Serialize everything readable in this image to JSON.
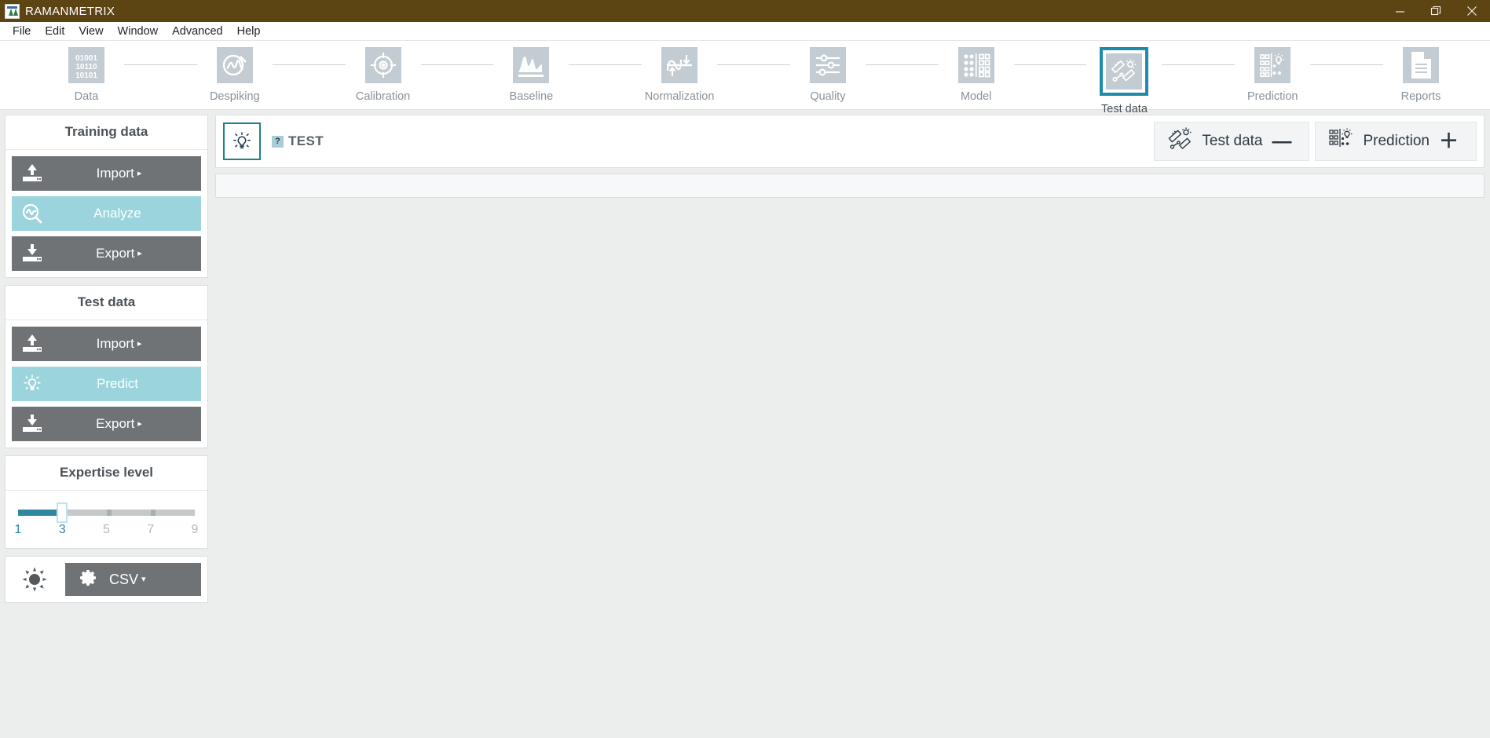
{
  "window": {
    "title": "RAMANMETRIX",
    "logo_icon": "app-logo-icon",
    "minimize_icon": "minimize-icon",
    "maximize_icon": "restore-icon",
    "close_icon": "close-icon",
    "titlebar_color": "#5c4413"
  },
  "menubar": {
    "items": [
      {
        "label": "File"
      },
      {
        "label": "Edit"
      },
      {
        "label": "View"
      },
      {
        "label": "Window"
      },
      {
        "label": "Advanced"
      },
      {
        "label": "Help"
      }
    ]
  },
  "workflow": {
    "active_color": "#1e8ba8",
    "steps": [
      {
        "label": "Data",
        "icon": "binary-data-icon",
        "active": false
      },
      {
        "label": "Despiking",
        "icon": "despike-icon",
        "active": false
      },
      {
        "label": "Calibration",
        "icon": "target-icon",
        "active": false
      },
      {
        "label": "Baseline",
        "icon": "spectrum-icon",
        "active": false
      },
      {
        "label": "Normalization",
        "icon": "normalize-icon",
        "active": false
      },
      {
        "label": "Quality",
        "icon": "sliders-icon",
        "active": false
      },
      {
        "label": "Model",
        "icon": "model-matrix-icon",
        "active": false
      },
      {
        "label": "Test data",
        "icon": "test-data-icon",
        "active": true
      },
      {
        "label": "Prediction",
        "icon": "prediction-icon",
        "active": false
      },
      {
        "label": "Reports",
        "icon": "document-icon",
        "active": false
      }
    ]
  },
  "sidebar": {
    "training": {
      "title": "Training data",
      "buttons": [
        {
          "label": "Import",
          "icon": "upload-icon",
          "caret": "▸",
          "style": "gray"
        },
        {
          "label": "Analyze",
          "icon": "analyze-icon",
          "caret": "",
          "style": "teal"
        },
        {
          "label": "Export",
          "icon": "download-icon",
          "caret": "▸",
          "style": "gray"
        }
      ]
    },
    "test": {
      "title": "Test data",
      "buttons": [
        {
          "label": "Import",
          "icon": "upload-icon",
          "caret": "▸",
          "style": "gray"
        },
        {
          "label": "Predict",
          "icon": "lightbulb-icon",
          "caret": "",
          "style": "teal"
        },
        {
          "label": "Export",
          "icon": "download-icon",
          "caret": "▸",
          "style": "gray"
        }
      ]
    },
    "expertise": {
      "title": "Expertise level",
      "value": 3,
      "min": 1,
      "max": 9,
      "labels": [
        "1",
        "3",
        "5",
        "7",
        "9"
      ],
      "active_labels": [
        "1",
        "3"
      ],
      "fill_color": "#2d88a0"
    },
    "footer": {
      "brightness_icon": "sun-icon",
      "gear_icon": "gear-icon",
      "format_label": "CSV",
      "format_caret": "▾"
    }
  },
  "main": {
    "record": {
      "badge_icon": "lightbulb-icon",
      "help_marker": "?",
      "name": "TEST"
    },
    "actions": [
      {
        "label": "Test data",
        "icon": "test-data-icon",
        "sign": "—"
      },
      {
        "label": "Prediction",
        "icon": "prediction-icon",
        "sign": "＋"
      }
    ]
  }
}
